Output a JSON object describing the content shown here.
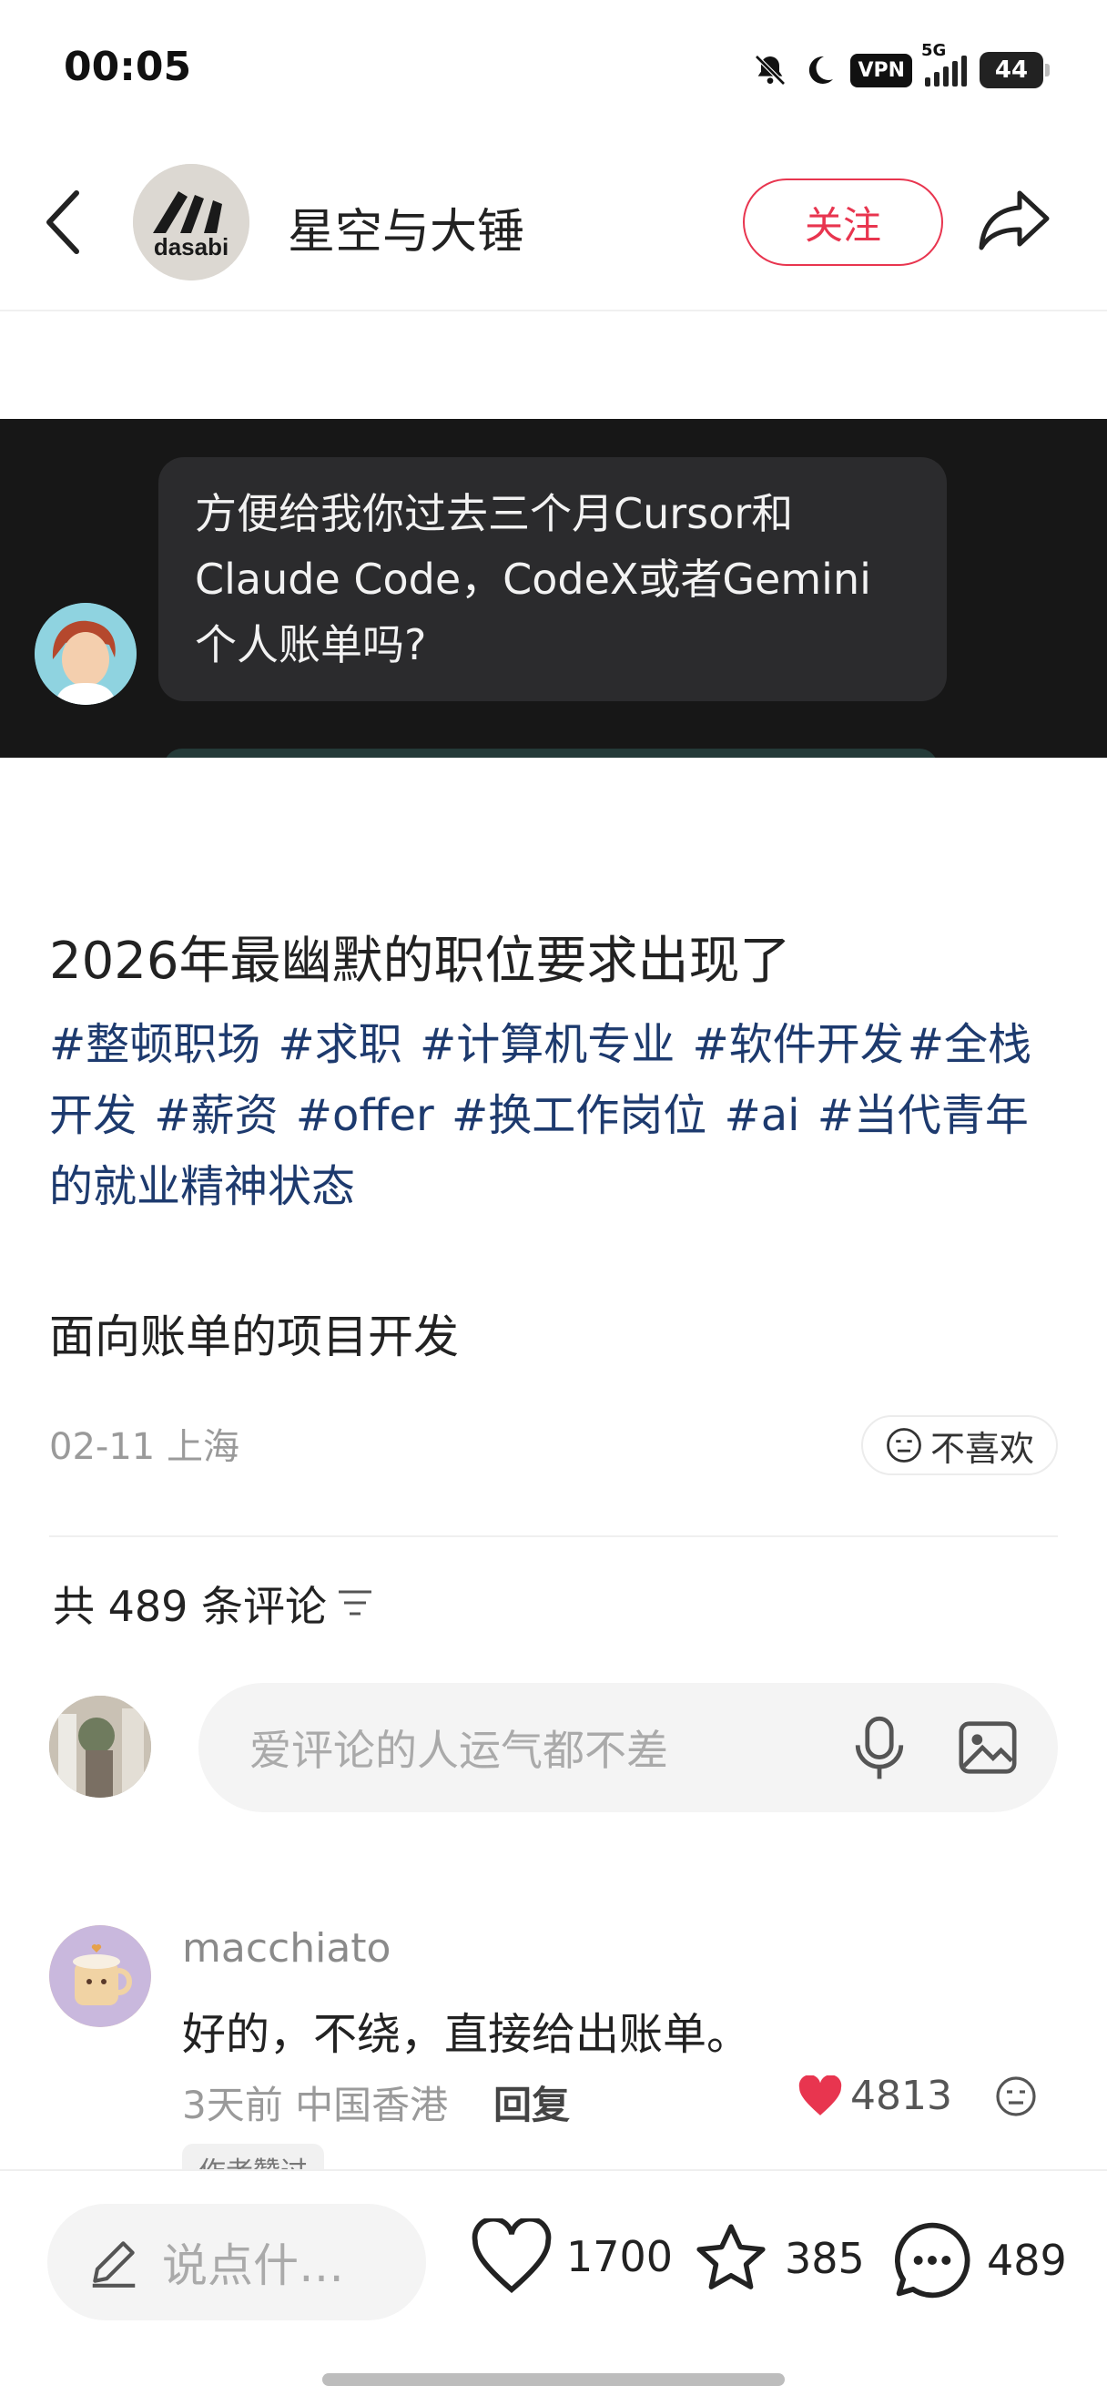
{
  "status_bar": {
    "time": "00:05",
    "vpn": "VPN",
    "network": "5G",
    "battery": "44"
  },
  "header": {
    "author_name": "星空与大锤",
    "follow_label": "关注"
  },
  "post_image": {
    "bubble_text": "方便给我你过去三个月Cursor和Claude Code，CodeX或者Gemini个人账单吗?"
  },
  "post": {
    "title": "2026年最幽默的职位要求出现了",
    "tags": [
      "#整顿职场",
      "#求职",
      "#计算机专业",
      "#软件开发",
      "#全栈开发",
      "#薪资",
      "#offer",
      "#换工作岗位",
      "#ai",
      "#当代青年的就业精神状态"
    ],
    "body": "面向账单的项目开发",
    "date_location": "02-11 上海",
    "dislike_label": "不喜欢"
  },
  "comments": {
    "count_label": "共 489 条评论",
    "input_placeholder": "爱评论的人运气都不差",
    "items": [
      {
        "user": "macchiato",
        "text": "好的，不绕，直接给出账单。",
        "meta": "3天前 中国香港",
        "reply_label": "回复",
        "likes": "4813",
        "badge": "作者赞过"
      }
    ]
  },
  "bottom_bar": {
    "input_label": "说点什…",
    "likes": "1700",
    "favorites": "385",
    "comments": "489"
  },
  "colors": {
    "accent": "#e8354f",
    "tag": "#1d3a6e"
  }
}
